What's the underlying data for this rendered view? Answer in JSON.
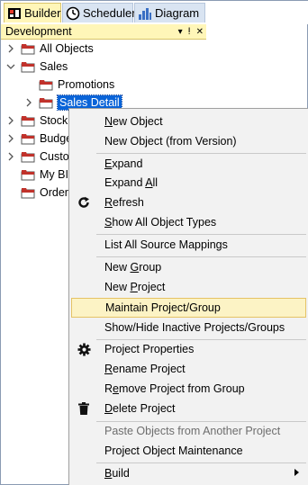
{
  "tabs": [
    {
      "label": "Builder",
      "icon": "builder-icon",
      "active": true
    },
    {
      "label": "Scheduler",
      "icon": "clock-icon",
      "active": false
    },
    {
      "label": "Diagram",
      "icon": "diagram-icon",
      "active": false
    }
  ],
  "panel": {
    "title": "Development",
    "controls": [
      "▾",
      "ⵑ",
      "✕"
    ]
  },
  "tree": [
    {
      "label": "All Objects",
      "expanded": false
    },
    {
      "label": "Sales",
      "expanded": true
    },
    {
      "label": "Promotions"
    },
    {
      "label": "Sales Detail",
      "selected": true
    },
    {
      "label": "Stock"
    },
    {
      "label": "Budge"
    },
    {
      "label": "Custo"
    },
    {
      "label": "My BI"
    },
    {
      "label": "Orders"
    }
  ],
  "menu": {
    "items": [
      {
        "label": "New Object",
        "accel": "N"
      },
      {
        "label": "New Object (from Version)"
      },
      {
        "label": "Expand",
        "accel": "E"
      },
      {
        "label": "Expand All",
        "accel": "A"
      },
      {
        "label": "Refresh",
        "accel": "R",
        "icon": "refresh-icon"
      },
      {
        "label": "Show All Object Types",
        "accel": "S"
      },
      {
        "label": "List All Source Mappings"
      },
      {
        "label": "New Group",
        "accel": "G"
      },
      {
        "label": "New Project",
        "accel": "P"
      },
      {
        "label": "Maintain Project/Group",
        "hover": true
      },
      {
        "label": "Show/Hide Inactive Projects/Groups"
      },
      {
        "label": "Project Properties",
        "icon": "gear-icon"
      },
      {
        "label": "Rename Project",
        "accel": "R"
      },
      {
        "label": "Remove Project from Group",
        "accel": "e"
      },
      {
        "label": "Delete Project",
        "accel": "D",
        "icon": "trash-icon"
      },
      {
        "label": "Paste Objects from Another Project",
        "disabled": true
      },
      {
        "label": "Project Object Maintenance"
      },
      {
        "label": "Build",
        "accel": "B",
        "submenu": true
      }
    ]
  },
  "colors": {
    "selection": "#0a64d8",
    "menu_hover": "#fcf3c5",
    "panel_header": "#fff6b8",
    "folder_red": "#c0322b"
  }
}
